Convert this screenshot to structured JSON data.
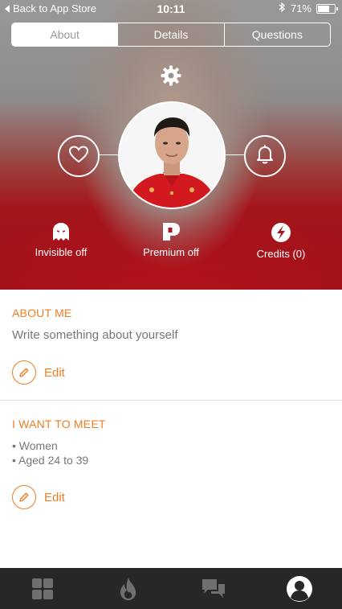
{
  "status_bar": {
    "back_label": "Back to App Store",
    "time": "10:11",
    "battery": "71%",
    "battery_level": 0.71
  },
  "tabs": [
    {
      "label": "About",
      "active": true
    },
    {
      "label": "Details",
      "active": false
    },
    {
      "label": "Questions",
      "active": false
    }
  ],
  "profile": {
    "icons": {
      "settings": "gear-icon",
      "like": "heart-icon",
      "notifications": "bell-icon",
      "photo": "user-photo"
    },
    "stats": [
      {
        "icon": "ghost-icon",
        "label": "Invisible off"
      },
      {
        "icon": "premium-p-icon",
        "label": "Premium off"
      },
      {
        "icon": "credits-bolt-icon",
        "label": "Credits (0)"
      }
    ]
  },
  "about_me": {
    "title": "ABOUT ME",
    "placeholder": "Write something about yourself",
    "edit_label": "Edit"
  },
  "want_to_meet": {
    "title": "I WANT TO MEET",
    "items": [
      "• Women",
      "• Aged 24 to 39"
    ],
    "edit_label": "Edit"
  },
  "tab_bar": [
    {
      "icon": "grid-icon",
      "active": false
    },
    {
      "icon": "flame-icon",
      "active": false
    },
    {
      "icon": "chat-icon",
      "active": false
    },
    {
      "icon": "profile-icon",
      "active": true
    }
  ],
  "colors": {
    "accent": "#ef7d22",
    "tab_bar": "#272727",
    "header_red": "#a5141b"
  }
}
